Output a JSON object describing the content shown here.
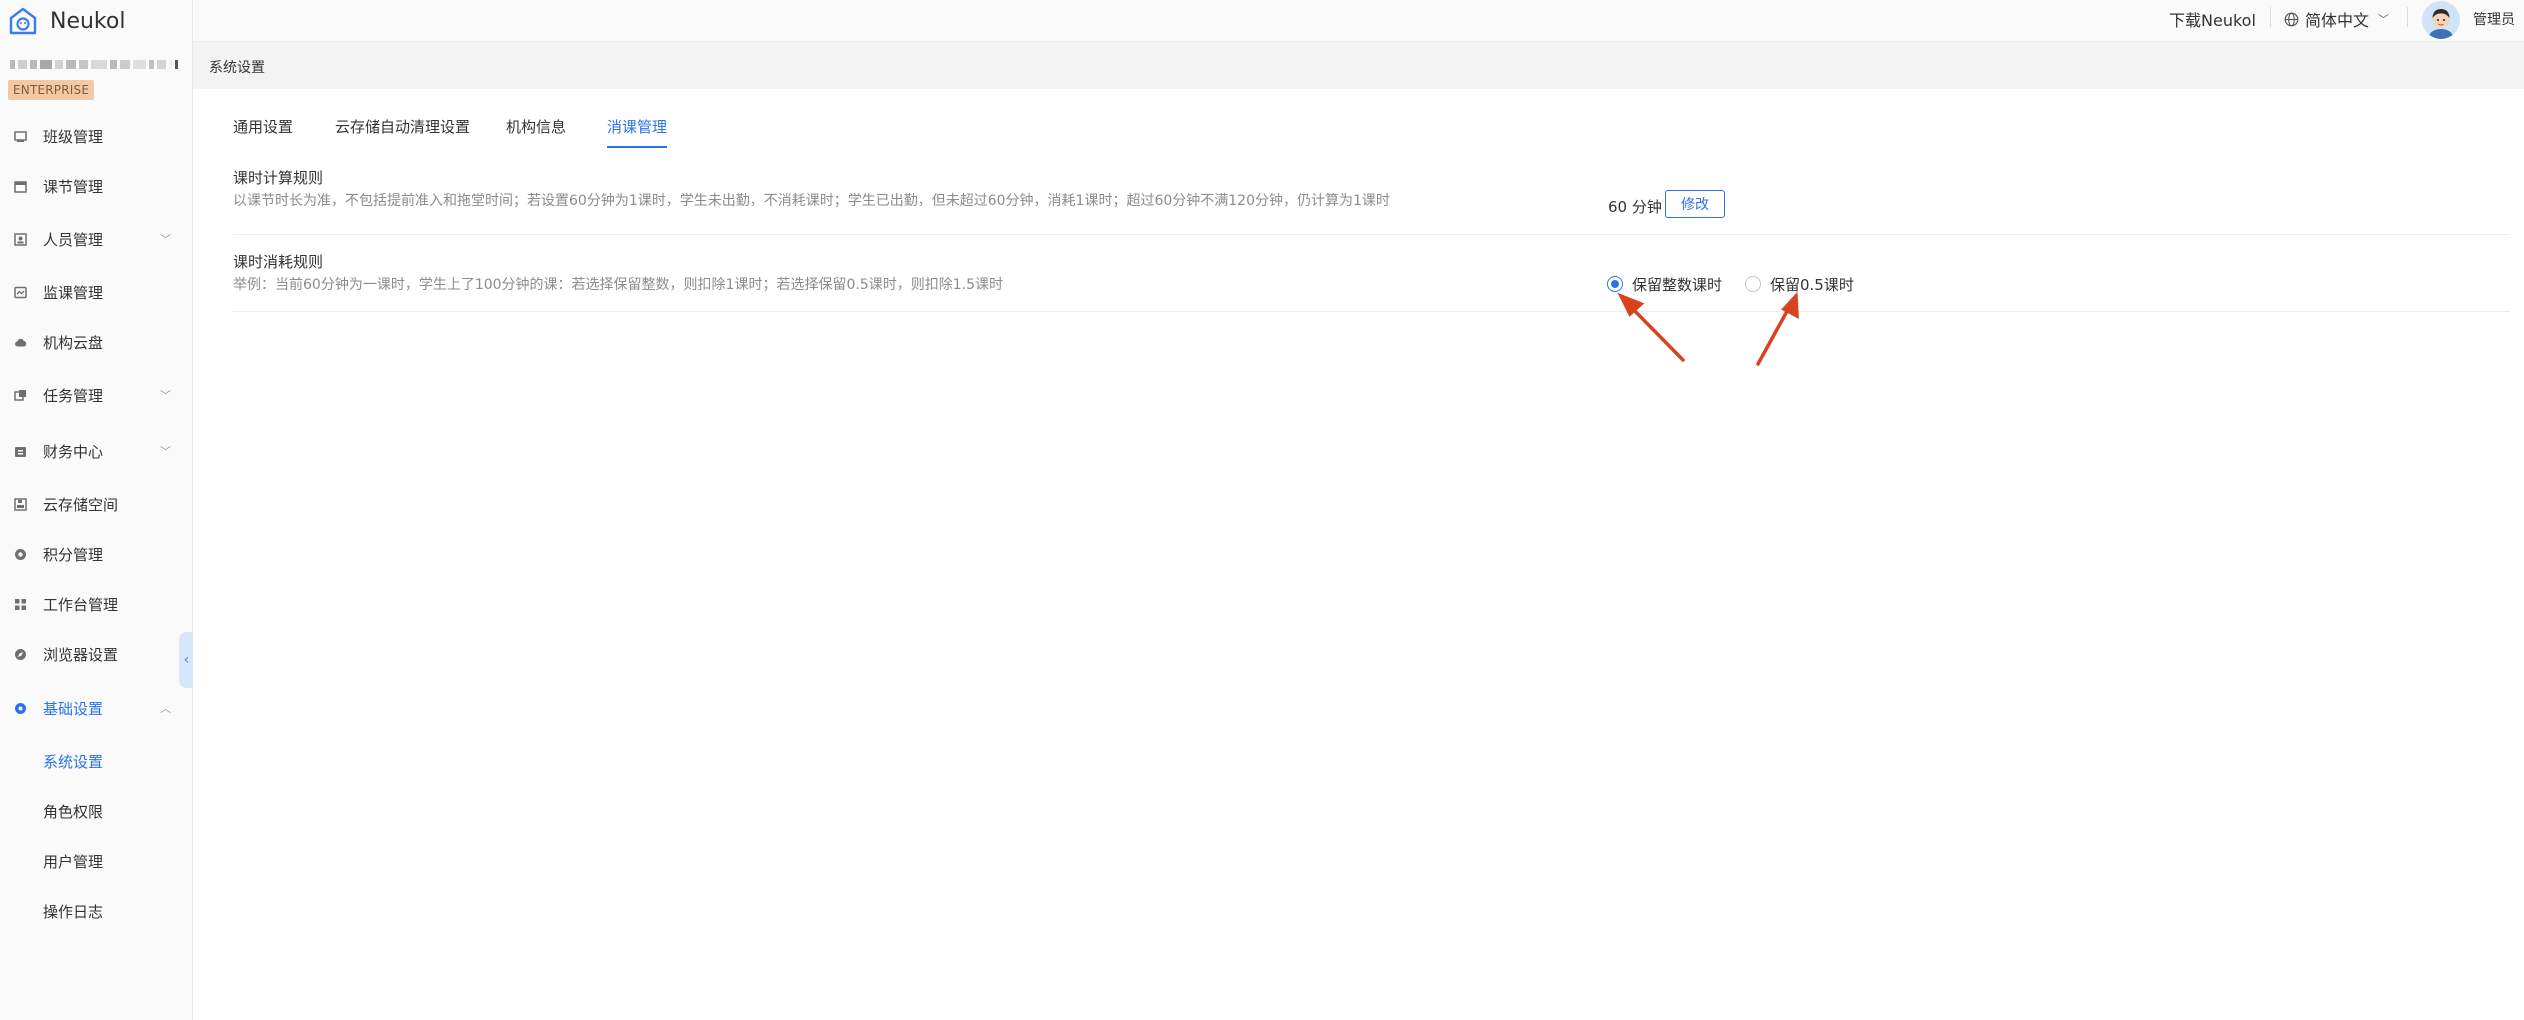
{
  "brand": {
    "name": "Neukol"
  },
  "org": {
    "badge": "ENTERPRISE"
  },
  "header": {
    "download": "下载Neukol",
    "language": "简体中文",
    "user": "管理员"
  },
  "sidebar": {
    "items": [
      {
        "label": "班级管理",
        "icon": "class-icon"
      },
      {
        "label": "课节管理",
        "icon": "calendar-icon"
      },
      {
        "label": "人员管理",
        "icon": "people-icon"
      },
      {
        "label": "监课管理",
        "icon": "monitor-icon"
      },
      {
        "label": "机构云盘",
        "icon": "cloud-icon"
      },
      {
        "label": "任务管理",
        "icon": "task-icon"
      },
      {
        "label": "财务中心",
        "icon": "finance-icon"
      },
      {
        "label": "云存储空间",
        "icon": "storage-icon"
      },
      {
        "label": "积分管理",
        "icon": "points-icon"
      },
      {
        "label": "工作台管理",
        "icon": "grid-icon"
      },
      {
        "label": "浏览器设置",
        "icon": "compass-icon"
      },
      {
        "label": "基础设置",
        "icon": "settings-icon"
      }
    ],
    "sub_items": [
      {
        "label": "系统设置"
      },
      {
        "label": "角色权限"
      },
      {
        "label": "用户管理"
      },
      {
        "label": "操作日志"
      }
    ]
  },
  "breadcrumb": "系统设置",
  "tabs": [
    {
      "label": "通用设置"
    },
    {
      "label": "云存储自动清理设置"
    },
    {
      "label": "机构信息"
    },
    {
      "label": "消课管理"
    }
  ],
  "rule1": {
    "title": "课时计算规则",
    "desc": "以课节时长为准，不包括提前准入和拖堂时间；若设置60分钟为1课时，学生未出勤，不消耗课时；学生已出勤，但未超过60分钟，消耗1课时；超过60分钟不满120分钟，仍计算为1课时",
    "value": "60 分钟",
    "edit": "修改"
  },
  "rule2": {
    "title": "课时消耗规则",
    "desc": "举例：当前60分钟为一课时，学生上了100分钟的课：若选择保留整数，则扣除1课时；若选择保留0.5课时，则扣除1.5课时",
    "option1": "保留整数课时",
    "option2": "保留0.5课时",
    "selected": "保留整数课时"
  },
  "colors": {
    "accent": "#2b73e8",
    "badge_bg": "#f2c8a7",
    "arrow": "#d8431f"
  }
}
